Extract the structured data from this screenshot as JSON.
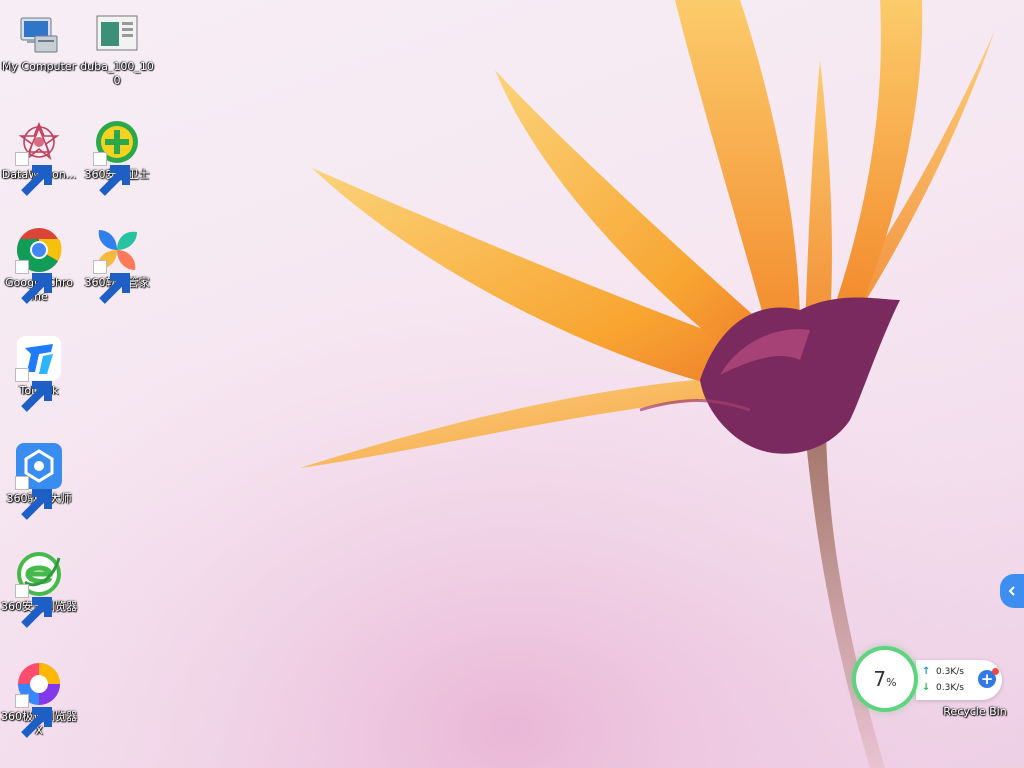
{
  "desktop": {
    "icons": [
      {
        "label": "My Computer"
      },
      {
        "label": "duba_100_100"
      },
      {
        "label": "DataWagon..."
      },
      {
        "label": "360安全卫士"
      },
      {
        "label": "Google Chrome"
      },
      {
        "label": "360软件管家"
      },
      {
        "label": "ToDesk"
      },
      {
        "label": "360驱动大师"
      },
      {
        "label": "360安全浏览器"
      },
      {
        "label": "360极速浏览器X"
      }
    ],
    "recycle_bin": {
      "label": "Recycle Bin"
    }
  },
  "speed_widget": {
    "percent": "7",
    "percent_sign": "%",
    "upload": "0.3K/s",
    "download": "0.3K/s",
    "up_arrow": "↑",
    "down_arrow": "↓",
    "plus": "+"
  },
  "colors": {
    "accent_blue": "#3d8ef0",
    "ring_green": "#5fd37f",
    "petal_orange": "#f7a93a",
    "flower_purple": "#7a2a5e"
  }
}
